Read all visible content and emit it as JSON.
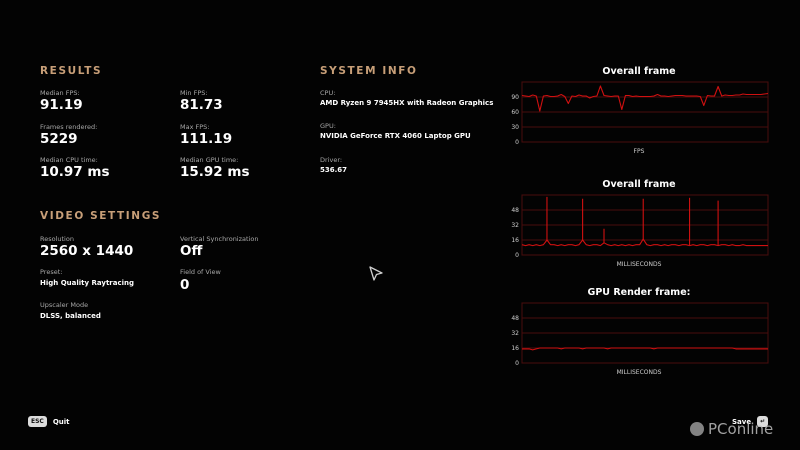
{
  "results": {
    "title": "RESULTS",
    "median_fps_label": "Median FPS:",
    "median_fps": "91.19",
    "min_fps_label": "Min FPS:",
    "min_fps": "81.73",
    "frames_rendered_label": "Frames rendered:",
    "frames_rendered": "5229",
    "max_fps_label": "Max FPS:",
    "max_fps": "111.19",
    "median_cpu_label": "Median CPU time:",
    "median_cpu": "10.97 ms",
    "median_gpu_label": "Median GPU time:",
    "median_gpu": "15.92 ms"
  },
  "system_info": {
    "title": "SYSTEM INFO",
    "cpu_label": "CPU:",
    "cpu": "AMD Ryzen 9 7945HX with Radeon Graphics",
    "gpu_label": "GPU:",
    "gpu": "NVIDIA GeForce RTX 4060 Laptop GPU",
    "driver_label": "Driver:",
    "driver": "536.67"
  },
  "video_settings": {
    "title": "VIDEO SETTINGS",
    "resolution_label": "Resolution",
    "resolution": "2560 x 1440",
    "vsync_label": "Vertical Synchronization",
    "vsync": "Off",
    "preset_label": "Preset:",
    "preset": "High Quality Raytracing",
    "fov_label": "Field of View",
    "fov": "0",
    "upscaler_label": "Upscaler Mode",
    "upscaler": "DLSS, balanced"
  },
  "charts": [
    {
      "title": "Overall frame",
      "xlabel": "FPS",
      "yticks": [
        "90",
        "60",
        "30",
        "0"
      ],
      "ylim": [
        0,
        120
      ],
      "values": [
        93,
        92,
        91,
        94,
        92,
        62,
        92,
        93,
        91,
        91,
        92,
        95,
        91,
        77,
        92,
        91,
        94,
        92,
        92,
        88,
        91,
        92,
        112,
        93,
        92,
        91,
        92,
        92,
        65,
        93,
        93,
        91,
        92,
        91,
        91,
        91,
        91,
        92,
        95,
        92,
        92,
        91,
        92,
        93,
        93,
        93,
        92,
        92,
        92,
        92,
        91,
        73,
        93,
        92,
        92,
        111,
        92,
        94,
        93,
        93,
        94,
        94,
        96,
        95,
        95,
        95,
        95,
        95,
        96,
        97
      ]
    },
    {
      "title": "Overall frame",
      "xlabel": "MILLISECONDS",
      "yticks": [
        "48",
        "32",
        "16",
        "0"
      ],
      "ylim": [
        0,
        64
      ],
      "values": [
        11,
        10,
        11,
        10,
        11,
        10,
        11,
        16,
        11,
        11,
        10,
        11,
        10,
        11,
        11,
        10,
        11,
        16,
        11,
        10,
        11,
        11,
        10,
        13,
        11,
        10,
        11,
        10,
        11,
        10,
        11,
        10,
        11,
        11,
        17,
        11,
        10,
        11,
        11,
        10,
        11,
        10,
        11,
        11,
        10,
        11,
        11,
        10,
        11,
        10,
        11,
        11,
        10,
        11,
        11,
        10,
        11,
        11,
        10,
        11,
        10,
        10,
        11,
        10,
        10,
        10,
        10,
        10,
        10,
        10
      ],
      "spikes": [
        [
          7,
          62
        ],
        [
          17,
          60
        ],
        [
          23,
          28
        ],
        [
          34,
          60
        ],
        [
          47,
          61
        ],
        [
          55,
          58
        ]
      ]
    },
    {
      "title": "GPU Render frame:",
      "xlabel": "MILLISECONDS",
      "yticks": [
        "48",
        "32",
        "16",
        "0"
      ],
      "ylim": [
        0,
        64
      ],
      "values": [
        15,
        15,
        15,
        14,
        15,
        16,
        16,
        16,
        16,
        16,
        16,
        15,
        16,
        16,
        16,
        16,
        16,
        15,
        16,
        16,
        16,
        16,
        16,
        16,
        15,
        16,
        16,
        16,
        16,
        16,
        16,
        16,
        16,
        16,
        16,
        16,
        16,
        15,
        16,
        16,
        16,
        16,
        16,
        16,
        16,
        16,
        16,
        16,
        16,
        16,
        16,
        16,
        16,
        16,
        16,
        16,
        16,
        16,
        16,
        16,
        15,
        15,
        15,
        15,
        15,
        15,
        15,
        15,
        15,
        15
      ]
    }
  ],
  "footer": {
    "quit_key": "ESC",
    "quit_label": "Quit",
    "save_label": "Save",
    "save_key": "↵"
  },
  "watermark": {
    "text": "PConline"
  },
  "colors": {
    "accent": "#c89f78",
    "chart_line": "#d01010",
    "chart_grid": "#4a0d0d"
  }
}
